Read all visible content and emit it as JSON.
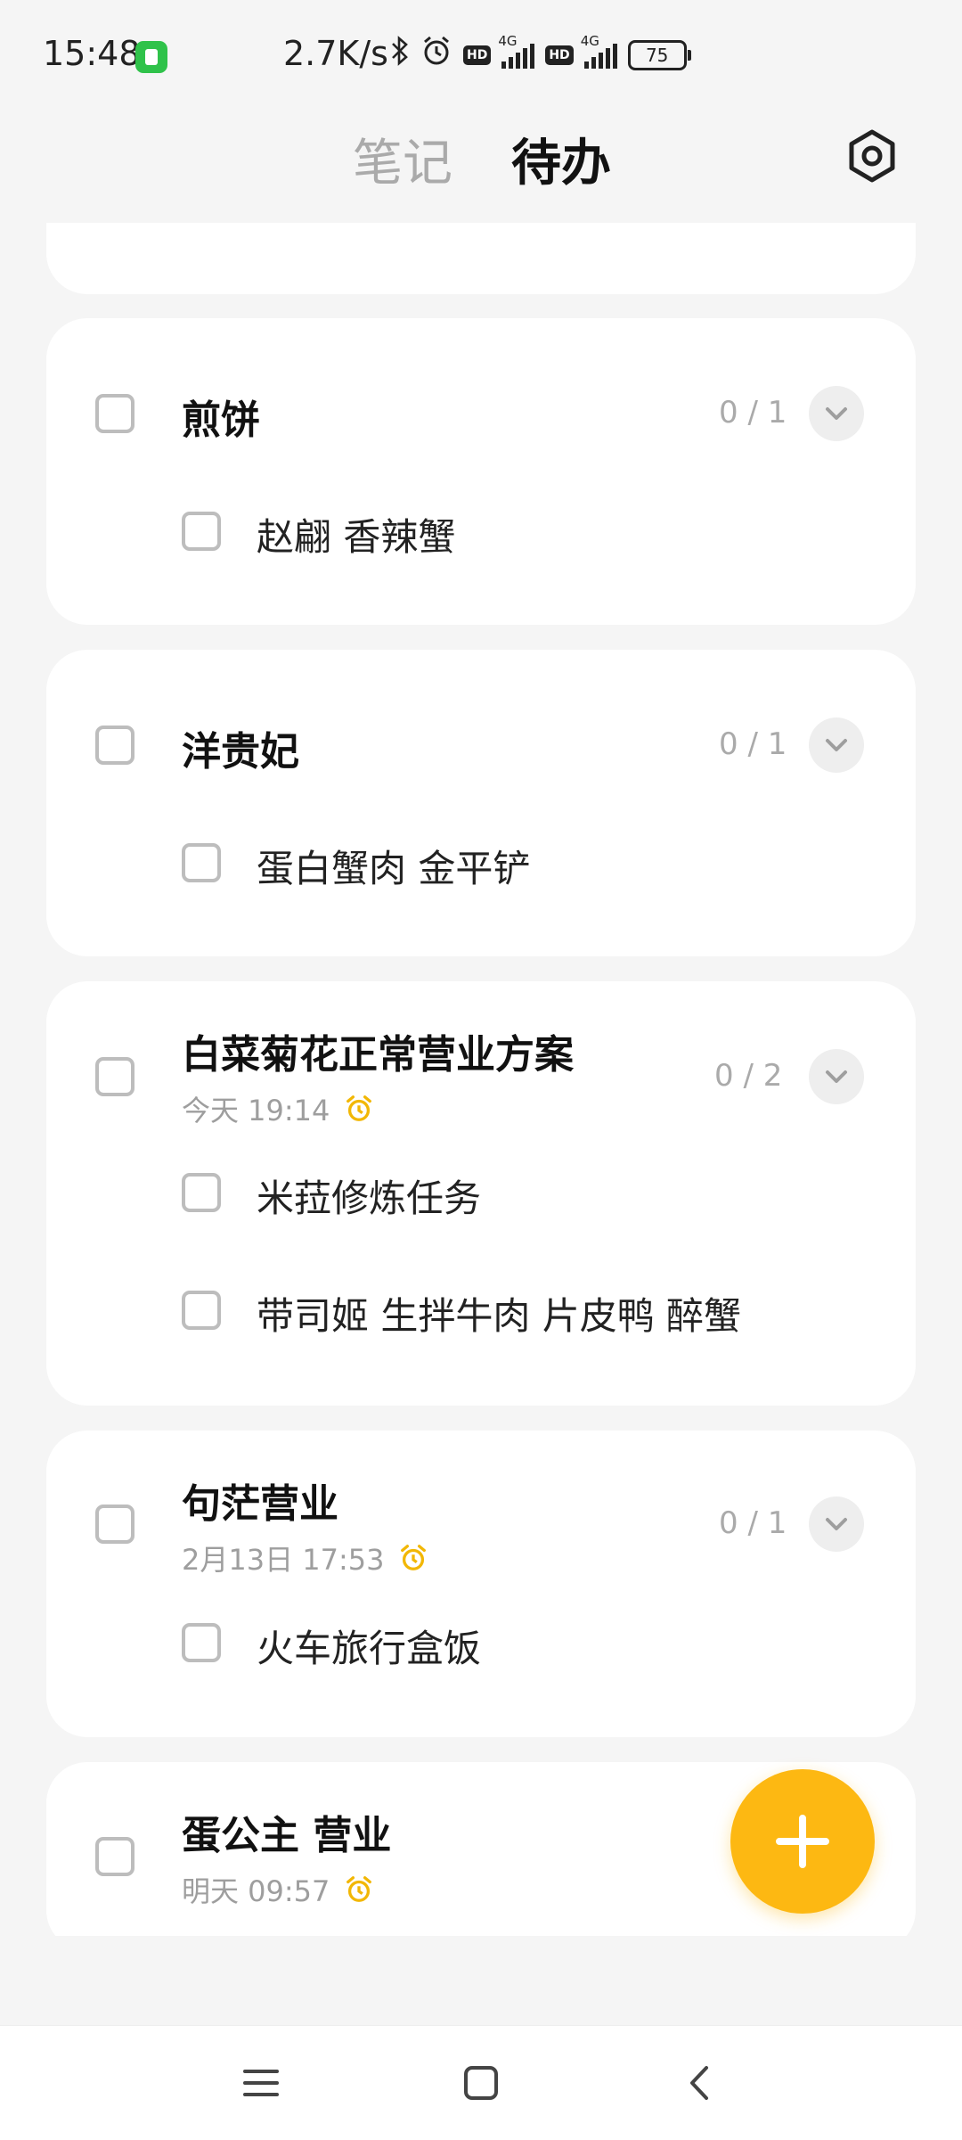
{
  "status_bar": {
    "time": "15:48",
    "net_speed": "2.7K/s",
    "bluetooth_icon": "bluetooth-icon",
    "alarm_icon": "alarm-clock-icon",
    "hd_label": "HD",
    "network_type": "4G",
    "battery": "75"
  },
  "header": {
    "tabs": [
      {
        "label": "笔记",
        "active": false
      },
      {
        "label": "待办",
        "active": true
      }
    ],
    "settings_icon": "settings-icon"
  },
  "todo_groups": [
    {
      "title": "煎饼",
      "count": "0 / 1",
      "reminder": "",
      "subtasks": [
        "赵翩 香辣蟹"
      ]
    },
    {
      "title": "洋贵妃",
      "count": "0 / 1",
      "reminder": "",
      "subtasks": [
        "蛋白蟹肉 金平铲"
      ]
    },
    {
      "title": "白菜菊花正常营业方案",
      "count": "0 / 2",
      "reminder": "今天 19:14",
      "subtasks": [
        "米菈修炼任务",
        "带司姬 生拌牛肉 片皮鸭 醉蟹"
      ]
    },
    {
      "title": "句茫营业",
      "count": "0 / 1",
      "reminder": "2月13日 17:53",
      "subtasks": [
        "火车旅行盒饭"
      ]
    },
    {
      "title": "蛋公主 营业",
      "count": "",
      "reminder": "明天 09:57",
      "subtasks": []
    }
  ],
  "fab": {
    "icon": "plus-icon"
  },
  "nav_bar": {
    "icons": [
      "menu-icon",
      "home-icon",
      "back-icon"
    ]
  },
  "colors": {
    "accent": "#fdb812",
    "alarm": "#f2b705",
    "background": "#f5f5f5",
    "card": "#ffffff"
  }
}
